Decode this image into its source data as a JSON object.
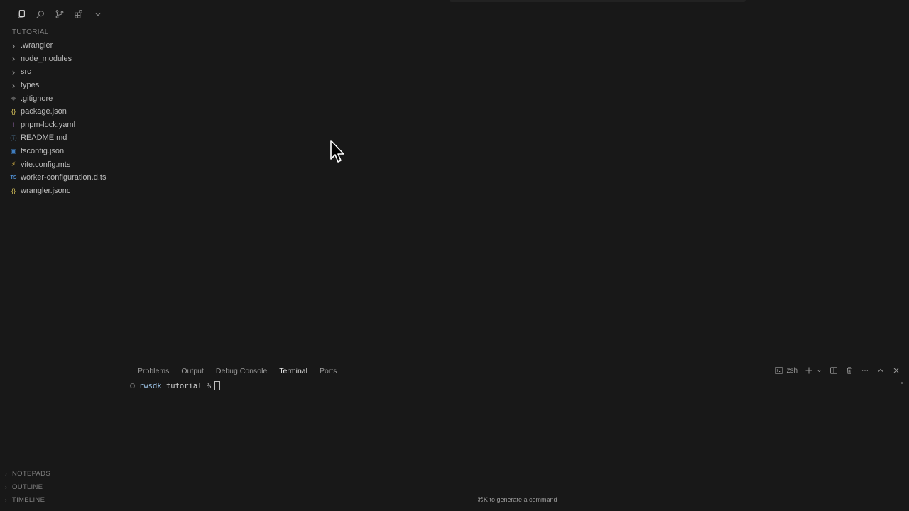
{
  "explorer": {
    "title": "TUTORIAL",
    "items": [
      {
        "label": ".wrangler",
        "icon": "chevron-right-icon",
        "glyph": "›",
        "color": "#9a9a9a"
      },
      {
        "label": "node_modules",
        "icon": "chevron-right-icon",
        "glyph": "›",
        "color": "#9a9a9a"
      },
      {
        "label": "src",
        "icon": "chevron-right-icon",
        "glyph": "›",
        "color": "#9a9a9a"
      },
      {
        "label": "types",
        "icon": "chevron-right-icon",
        "glyph": "›",
        "color": "#9a9a9a"
      },
      {
        "label": ".gitignore",
        "icon": "git-file-icon",
        "glyph": "◆",
        "color": "#5a5a5a"
      },
      {
        "label": "package.json",
        "icon": "json-file-icon",
        "glyph": "{}",
        "color": "#d7c25a"
      },
      {
        "label": "pnpm-lock.yaml",
        "icon": "yaml-file-icon",
        "glyph": "!",
        "color": "#c183e0"
      },
      {
        "label": "README.md",
        "icon": "info-file-icon",
        "glyph": "ⓘ",
        "color": "#6aa6d8"
      },
      {
        "label": "tsconfig.json",
        "icon": "tsconfig-file-icon",
        "glyph": "▣",
        "color": "#3f7dbf"
      },
      {
        "label": "vite.config.mts",
        "icon": "vite-file-icon",
        "glyph": "⚡",
        "color": "#e8c14a"
      },
      {
        "label": "worker-configuration.d.ts",
        "icon": "typescript-file-icon",
        "glyph": "TS",
        "color": "#4f8ed0"
      },
      {
        "label": "wrangler.jsonc",
        "icon": "json-file-icon",
        "glyph": "{}",
        "color": "#d7c25a"
      }
    ],
    "bottom_sections": [
      "NOTEPADS",
      "OUTLINE",
      "TIMELINE"
    ]
  },
  "panel": {
    "tabs": [
      "Problems",
      "Output",
      "Debug Console",
      "Terminal",
      "Ports"
    ],
    "active_tab": "Terminal",
    "shell_label": "zsh",
    "terminal": {
      "dir": "rwsdk",
      "text": "tutorial %"
    },
    "hint": "⌘K to generate a command"
  }
}
